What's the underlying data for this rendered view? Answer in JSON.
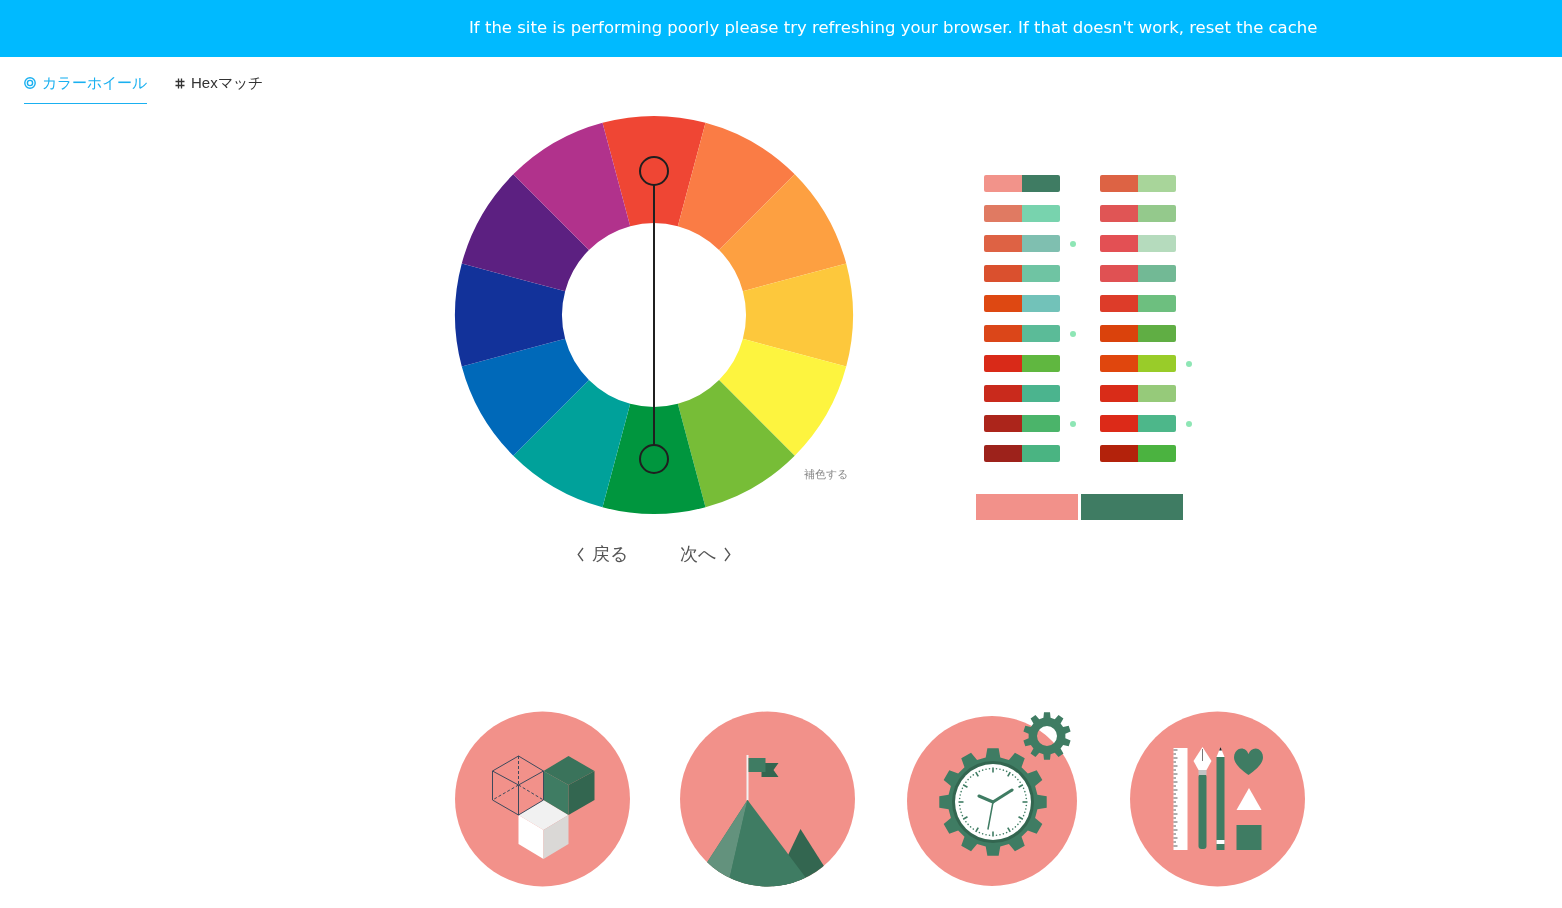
{
  "banner": {
    "text": "If the site is performing poorly please try refreshing your browser. If that doesn't work, reset the cache"
  },
  "tabs": [
    {
      "label": "カラーホイール",
      "kind": "wheel",
      "selected": true
    },
    {
      "label": "Hexマッチ",
      "kind": "hex",
      "selected": false
    }
  ],
  "wheel": {
    "segments": [
      {
        "color": "#ef4634",
        "selected": true
      },
      {
        "color": "#fa7c45",
        "selected": false
      },
      {
        "color": "#fda041",
        "selected": false
      },
      {
        "color": "#fdc83c",
        "selected": false
      },
      {
        "color": "#fdf43f",
        "selected": false
      },
      {
        "color": "#77bd37",
        "selected": false
      },
      {
        "color": "#00963e",
        "selected": true
      },
      {
        "color": "#00a19a",
        "selected": false
      },
      {
        "color": "#0069b9",
        "selected": false
      },
      {
        "color": "#12329a",
        "selected": false
      },
      {
        "color": "#5c2081",
        "selected": false
      },
      {
        "color": "#b1328c",
        "selected": false
      }
    ],
    "scheme_label": "補色する"
  },
  "navigation": {
    "previous": "戻る",
    "next": "次へ"
  },
  "palettes": {
    "columns": [
      {
        "rows": [
          {
            "swatches": [
              {
                "color": "#f2938a"
              },
              {
                "color": "#3f7c63"
              }
            ],
            "marked": false
          },
          {
            "swatches": [
              {
                "color": "#e07a62"
              },
              {
                "color": "#78d3ae"
              }
            ],
            "marked": false
          },
          {
            "swatches": [
              {
                "color": "#de6244"
              },
              {
                "color": "#7fbfb0"
              }
            ],
            "marked": true
          },
          {
            "swatches": [
              {
                "color": "#da502e"
              },
              {
                "color": "#6fc4a3"
              }
            ],
            "marked": false
          },
          {
            "swatches": [
              {
                "color": "#de4812"
              },
              {
                "color": "#72c2b9"
              }
            ],
            "marked": false
          },
          {
            "swatches": [
              {
                "color": "#db4619"
              },
              {
                "color": "#5bbb98"
              }
            ],
            "marked": true
          },
          {
            "swatches": [
              {
                "color": "#d92a18"
              },
              {
                "color": "#60b740"
              }
            ],
            "marked": false
          },
          {
            "swatches": [
              {
                "color": "#c92a1c"
              },
              {
                "color": "#4bb48e"
              }
            ],
            "marked": false
          },
          {
            "swatches": [
              {
                "color": "#ac251b"
              },
              {
                "color": "#4bb46a"
              }
            ],
            "marked": true
          },
          {
            "swatches": [
              {
                "color": "#9d221b"
              },
              {
                "color": "#4ab482"
              }
            ],
            "marked": false
          }
        ]
      },
      {
        "rows": [
          {
            "swatches": [
              {
                "color": "#dd6344"
              },
              {
                "color": "#a8d59a"
              }
            ],
            "marked": false
          },
          {
            "swatches": [
              {
                "color": "#e05555"
              },
              {
                "color": "#94c98c"
              }
            ],
            "marked": false
          },
          {
            "swatches": [
              {
                "color": "#e35054"
              },
              {
                "color": "#b5dbbd"
              }
            ],
            "marked": false
          },
          {
            "swatches": [
              {
                "color": "#e05153"
              },
              {
                "color": "#72b995"
              }
            ],
            "marked": false
          },
          {
            "swatches": [
              {
                "color": "#dd3c29"
              },
              {
                "color": "#6dbf7f"
              }
            ],
            "marked": false
          },
          {
            "swatches": [
              {
                "color": "#da420c"
              },
              {
                "color": "#60ae44"
              }
            ],
            "marked": false
          },
          {
            "swatches": [
              {
                "color": "#e0460d"
              },
              {
                "color": "#99cc29"
              }
            ],
            "marked": true
          },
          {
            "swatches": [
              {
                "color": "#d92c18"
              },
              {
                "color": "#96ca7a"
              }
            ],
            "marked": false
          },
          {
            "swatches": [
              {
                "color": "#dc2a18"
              },
              {
                "color": "#4db78a"
              }
            ],
            "marked": true
          },
          {
            "swatches": [
              {
                "color": "#b3220b"
              },
              {
                "color": "#4bb340"
              }
            ],
            "marked": false
          }
        ]
      }
    ]
  },
  "preview": [
    {
      "color": "#f2918a"
    },
    {
      "color": "#3f7c63"
    }
  ],
  "illustrations": [
    {
      "kind": "cubes"
    },
    {
      "kind": "mountain"
    },
    {
      "kind": "clock"
    },
    {
      "kind": "tools"
    }
  ]
}
